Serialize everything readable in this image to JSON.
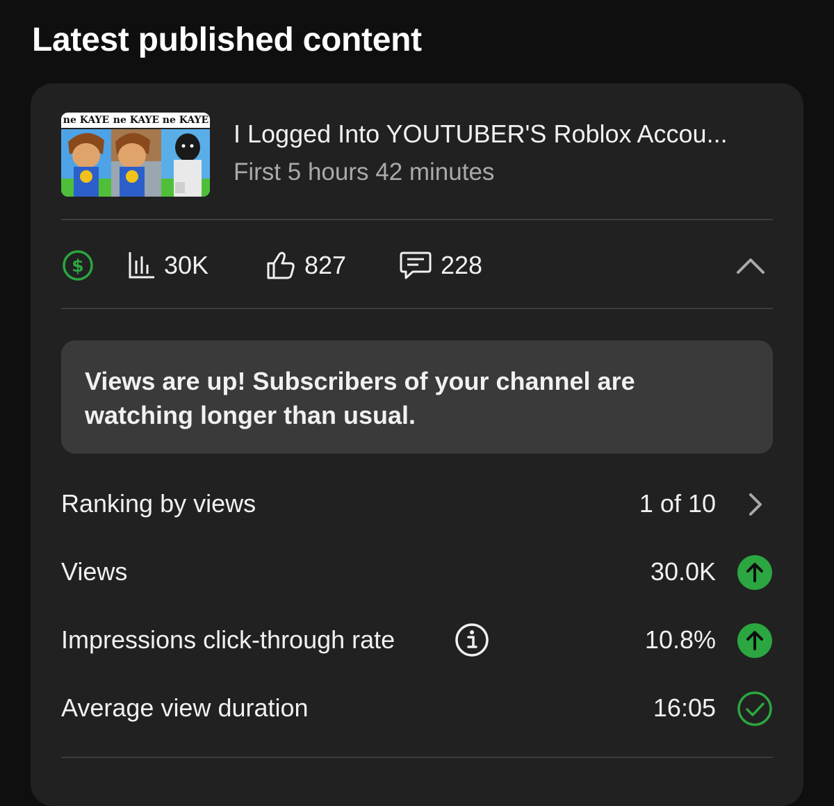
{
  "page": {
    "title": "Latest published content"
  },
  "video": {
    "title": "I Logged Into YOUTUBER'S Roblox Accou...",
    "subtitle": "First 5 hours 42 minutes",
    "thumbnail_banners": [
      "ne KAYE",
      "ne KAYE",
      "ne KAYE"
    ]
  },
  "stats": {
    "monetization_icon": "dollar-circle-icon",
    "views": "30K",
    "likes": "827",
    "comments": "228",
    "collapse_icon": "chevron-up-icon"
  },
  "insight": {
    "text": "Views are up! Subscribers of your channel are watching longer than usual."
  },
  "metrics": [
    {
      "label": "Ranking by views",
      "value": "1 of 10",
      "indicator": "chevron-right-icon"
    },
    {
      "label": "Views",
      "value": "30.0K",
      "indicator": "arrow-up-circle-icon"
    },
    {
      "label": "Impressions click-through rate",
      "value": "10.8%",
      "indicator": "arrow-up-circle-icon",
      "has_info": true
    },
    {
      "label": "Average view duration",
      "value": "16:05",
      "indicator": "check-circle-icon"
    }
  ],
  "colors": {
    "background": "#0f0f0f",
    "card": "#212121",
    "insight_box": "#3a3a3a",
    "positive_green": "#2ba640",
    "text_primary": "#f1f1f1",
    "text_secondary": "#aaaaaa"
  }
}
